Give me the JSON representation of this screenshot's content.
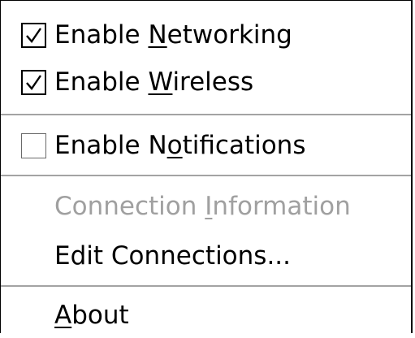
{
  "menu": {
    "items": [
      {
        "pre": "Enable ",
        "mn": "N",
        "post": "etworking",
        "checked": true
      },
      {
        "pre": "Enable ",
        "mn": "W",
        "post": "ireless",
        "checked": true
      },
      {
        "pre": "Enable N",
        "mn": "o",
        "post": "tifications",
        "checked": false
      },
      {
        "pre": "Connection ",
        "mn": "I",
        "post": "nformation",
        "enabled": false
      },
      {
        "pre": "Edit Connections...",
        "mn": "",
        "post": ""
      },
      {
        "pre": "",
        "mn": "A",
        "post": "bout"
      }
    ]
  },
  "icons": {
    "check": "check-mark-icon"
  },
  "colors": {
    "disabled_text": "#a0a0a0",
    "separator": "#a3a3a3"
  }
}
